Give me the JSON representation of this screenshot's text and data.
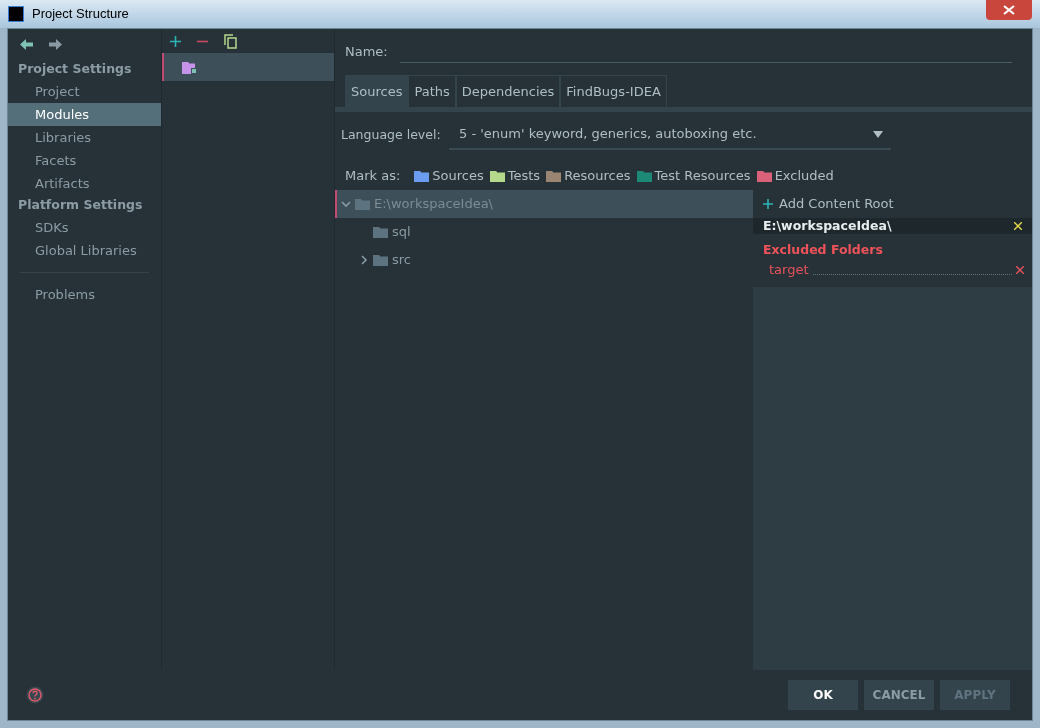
{
  "window": {
    "title": "Project Structure"
  },
  "sidebar": {
    "sections": [
      {
        "title": "Project Settings",
        "items": [
          {
            "label": "Project",
            "selected": false
          },
          {
            "label": "Modules",
            "selected": true
          },
          {
            "label": "Libraries",
            "selected": false
          },
          {
            "label": "Facets",
            "selected": false
          },
          {
            "label": "Artifacts",
            "selected": false
          }
        ]
      },
      {
        "title": "Platform Settings",
        "items": [
          {
            "label": "SDKs",
            "selected": false
          },
          {
            "label": "Global Libraries",
            "selected": false
          }
        ]
      }
    ],
    "extra": [
      {
        "label": "Problems",
        "selected": false
      }
    ]
  },
  "modules": [
    {
      "selected": true
    }
  ],
  "name_label": "Name:",
  "tabs": [
    {
      "label": "Sources",
      "selected": true
    },
    {
      "label": "Paths",
      "selected": false
    },
    {
      "label": "Dependencies",
      "selected": false
    },
    {
      "label": "FindBugs-IDEA",
      "selected": false
    }
  ],
  "language_level": {
    "label": "Language level:",
    "value": "5 - 'enum' keyword, generics, autoboxing etc."
  },
  "mark_as": {
    "label": "Mark as:",
    "items": [
      {
        "label": "Sources",
        "color": "#6b9cf0"
      },
      {
        "label": "Tests",
        "color": "#b5d98a"
      },
      {
        "label": "Resources",
        "color": "#9a8573"
      },
      {
        "label": "Test Resources",
        "color": "#1d8a78"
      },
      {
        "label": "Excluded",
        "color": "#d9627a"
      }
    ]
  },
  "tree": [
    {
      "label": "E:\\workspaceIdea\\",
      "expanded": true,
      "selected": true,
      "children": [
        {
          "label": "sql"
        },
        {
          "label": "src",
          "expanded": false
        }
      ]
    }
  ],
  "content_root": {
    "add_label": "Add Content Root",
    "path": "E:\\workspaceIdea\\",
    "excluded_title": "Excluded Folders",
    "excluded": [
      "target"
    ]
  },
  "buttons": [
    {
      "label": "OK",
      "disabled": false
    },
    {
      "label": "CANCEL",
      "disabled": false
    },
    {
      "label": "APPLY",
      "disabled": true
    }
  ]
}
